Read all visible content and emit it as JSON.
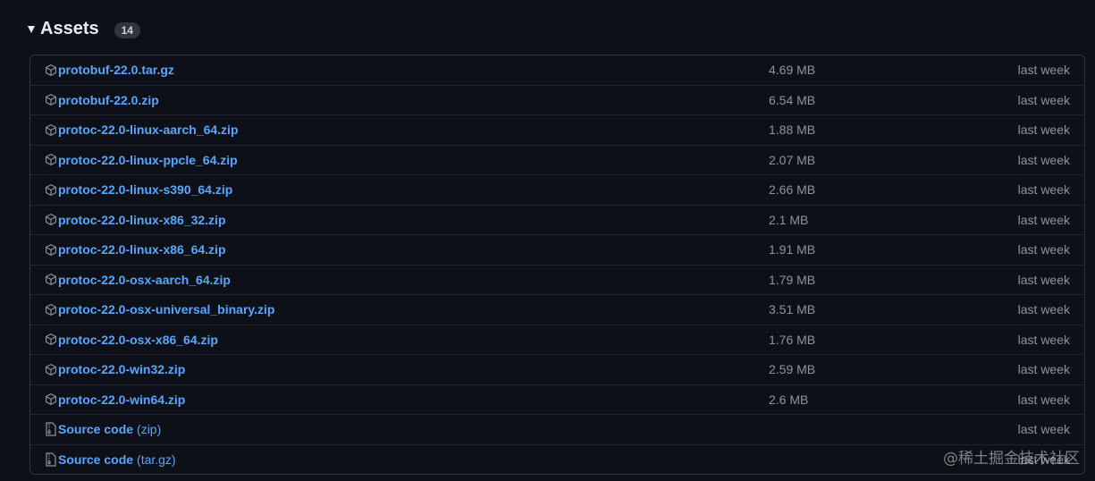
{
  "assets": {
    "title": "Assets",
    "count": "14",
    "items": [
      {
        "name": "protobuf-22.0.tar.gz",
        "size": "4.69 MB",
        "date": "last week",
        "type": "package"
      },
      {
        "name": "protobuf-22.0.zip",
        "size": "6.54 MB",
        "date": "last week",
        "type": "package"
      },
      {
        "name": "protoc-22.0-linux-aarch_64.zip",
        "size": "1.88 MB",
        "date": "last week",
        "type": "package"
      },
      {
        "name": "protoc-22.0-linux-ppcle_64.zip",
        "size": "2.07 MB",
        "date": "last week",
        "type": "package"
      },
      {
        "name": "protoc-22.0-linux-s390_64.zip",
        "size": "2.66 MB",
        "date": "last week",
        "type": "package"
      },
      {
        "name": "protoc-22.0-linux-x86_32.zip",
        "size": "2.1 MB",
        "date": "last week",
        "type": "package"
      },
      {
        "name": "protoc-22.0-linux-x86_64.zip",
        "size": "1.91 MB",
        "date": "last week",
        "type": "package"
      },
      {
        "name": "protoc-22.0-osx-aarch_64.zip",
        "size": "1.79 MB",
        "date": "last week",
        "type": "package"
      },
      {
        "name": "protoc-22.0-osx-universal_binary.zip",
        "size": "3.51 MB",
        "date": "last week",
        "type": "package"
      },
      {
        "name": "protoc-22.0-osx-x86_64.zip",
        "size": "1.76 MB",
        "date": "last week",
        "type": "package"
      },
      {
        "name": "protoc-22.0-win32.zip",
        "size": "2.59 MB",
        "date": "last week",
        "type": "package"
      },
      {
        "name": "protoc-22.0-win64.zip",
        "size": "2.6 MB",
        "date": "last week",
        "type": "package"
      },
      {
        "name": "Source code",
        "sub": "(zip)",
        "size": "",
        "date": "last week",
        "type": "file-zip"
      },
      {
        "name": "Source code",
        "sub": "(tar.gz)",
        "size": "",
        "date": "last week",
        "type": "file-zip"
      }
    ]
  },
  "watermark": "@稀土掘金技术社区",
  "colors": {
    "background": "#0d1117",
    "link": "#58a6ff",
    "muted": "#8b949e",
    "border": "#30363d"
  }
}
